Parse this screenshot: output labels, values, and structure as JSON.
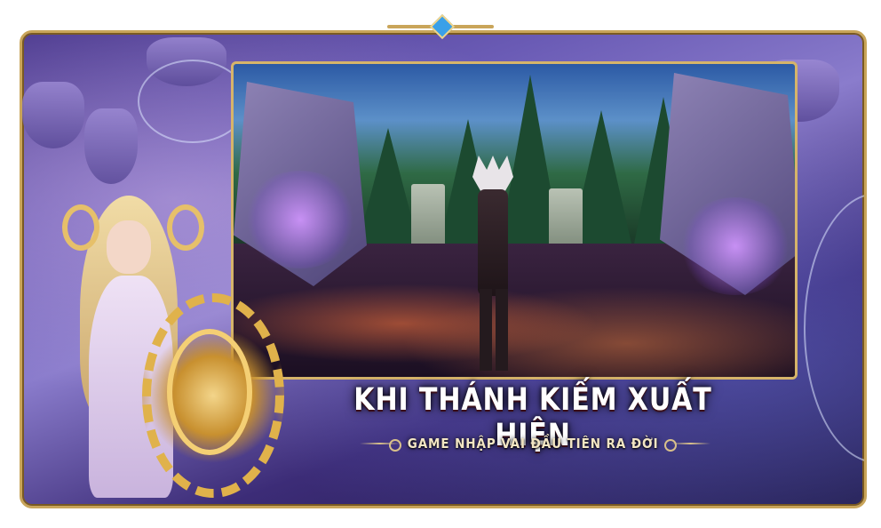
{
  "banner": {
    "title": "KHI THÁNH KIẾM XUẤT HIỆN",
    "subtitle": "GAME NHẬP VAI ĐẦU TIÊN RA ĐỜI"
  },
  "colors": {
    "frame_gold": "#c9a55a",
    "background_purple": "#4c3a8f",
    "gem_blue": "#3aa0e8",
    "title_text": "#ffffff",
    "subtitle_text": "#f3e6c4"
  },
  "icons": [
    "crest-gem-icon",
    "gear-emblem-icon"
  ]
}
